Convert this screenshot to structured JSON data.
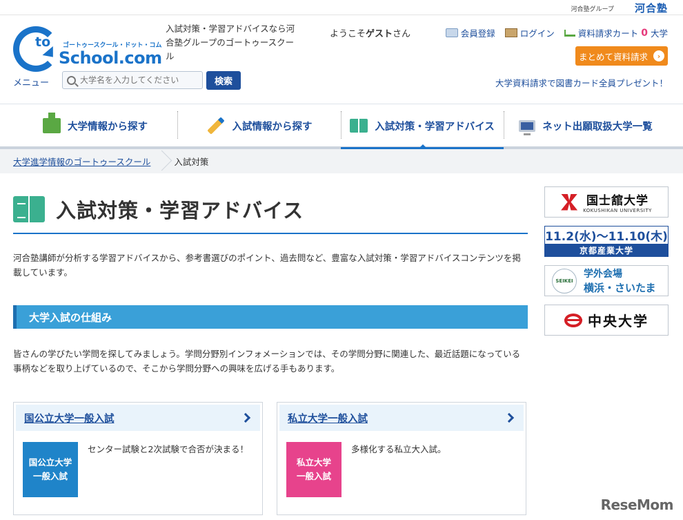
{
  "top": {
    "group": "河合塾グループ",
    "brand": "河合塾"
  },
  "logo": {
    "to": "to",
    "kana": "ゴートゥースクール・ドット・コム",
    "name": "School.com"
  },
  "header": {
    "tagline": "入試対策・学習アドバイスなら河合塾グループのゴートゥースクール",
    "welcome_prefix": "ようこそ",
    "welcome_name": "ゲスト",
    "welcome_suffix": "さん",
    "member_register": "会員登録",
    "login": "ログイン",
    "cart_label": "資料請求カート",
    "cart_count": "0",
    "cart_unit": "大学",
    "bulk_request": "まとめて資料請求",
    "menu": "メニュー",
    "search_placeholder": "大学名を入力してください",
    "search_button": "検索",
    "promo": "大学資料請求で図書カード全員プレゼント！"
  },
  "nav": {
    "tabs": [
      {
        "label": "大学情報から探す"
      },
      {
        "label": "入試情報から探す"
      },
      {
        "label": "入試対策・学習アドバイス"
      },
      {
        "label": "ネット出願取扱大学一覧"
      }
    ]
  },
  "breadcrumb": {
    "home": "大学進学情報のゴートゥースクール",
    "current": "入試対策"
  },
  "main": {
    "title": "入試対策・学習アドバイス",
    "intro": "河合塾講師が分析する学習アドバイスから、参考書選びのポイント、過去問など、豊富な入試対策・学習アドバイスコンテンツを掲載しています。",
    "section_title": "大学入試の仕組み",
    "section_text": "皆さんの学びたい学問を探してみましょう。学問分野別インフォメーションでは、その学問分野に関連した、最近話題になっている事柄などを取り上げているので、そこから学問分野への興味を広げる手もあります。",
    "cards": [
      {
        "title": "国公立大学一般入試",
        "thumb_l1": "国公立大学",
        "thumb_l2": "一般入試",
        "desc": "センター試験と2次試験で合否が決まる！",
        "color": "#1f84c9"
      },
      {
        "title": "私立大学一般入試",
        "thumb_l1": "私立大学",
        "thumb_l2": "一般入試",
        "desc": "多様化する私立大入試。",
        "color": "#e7438c"
      }
    ]
  },
  "sidebar": {
    "ad1": {
      "jp": "国士舘大学",
      "en": "KOKUSHIKAN UNIVERSITY"
    },
    "ad2": {
      "dates": "11.2(水)〜11.10(木)",
      "name": "京都産業大学"
    },
    "ad3": {
      "logo": "SEIKEI",
      "l1": "学外会場",
      "l2": "横浜・さいたま"
    },
    "ad4": {
      "name": "中央大学"
    }
  },
  "watermark": "ReseMom"
}
